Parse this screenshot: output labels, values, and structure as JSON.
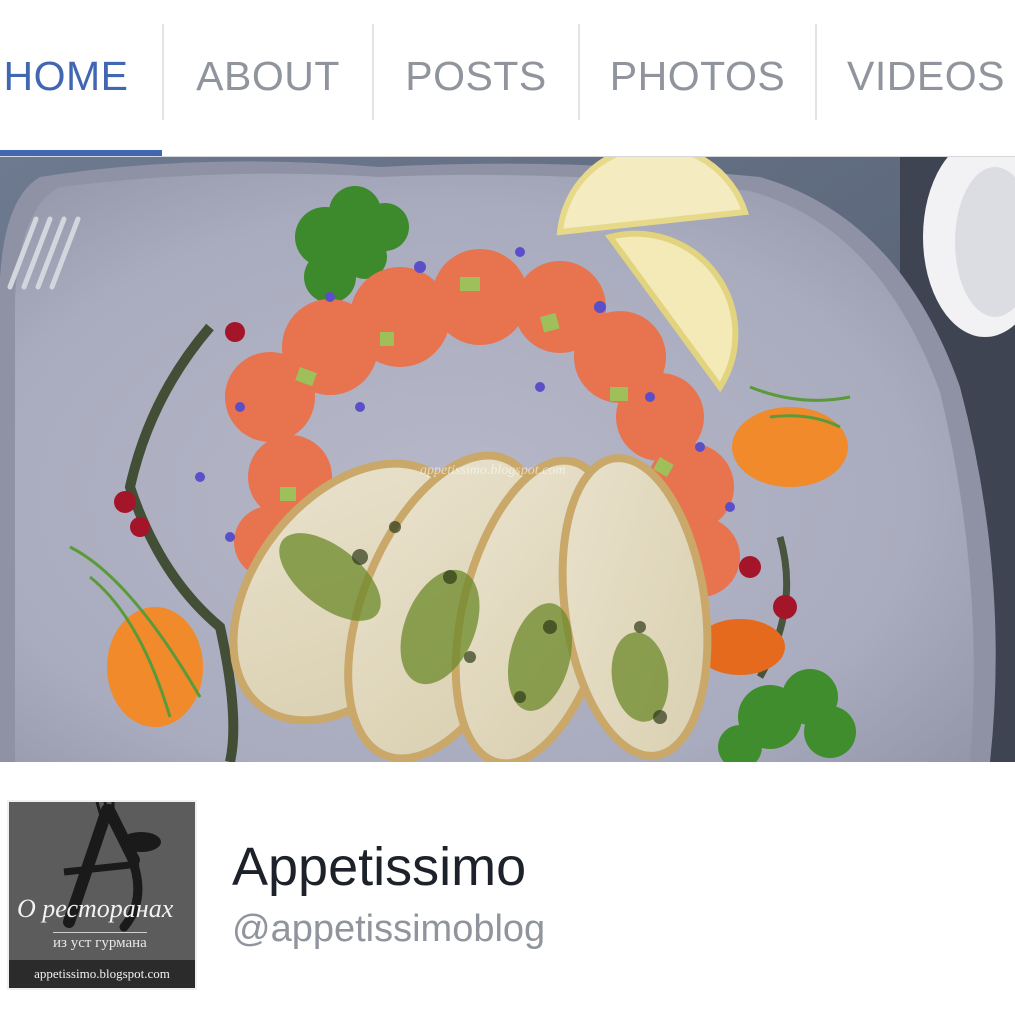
{
  "tabs": [
    {
      "label": "HOME",
      "active": true
    },
    {
      "label": "ABOUT",
      "active": false
    },
    {
      "label": "POSTS",
      "active": false
    },
    {
      "label": "PHOTOS",
      "active": false
    },
    {
      "label": "VIDEOS",
      "active": false
    }
  ],
  "profile": {
    "name": "Appetissimo",
    "handle": "@appetissimoblog",
    "avatar": {
      "script_line": "О ресторанах",
      "subline": "из уст гурмана",
      "site": "appetissimo.blogspot.com"
    }
  },
  "cover": {
    "watermark": "appetissimo.blogspot.com"
  },
  "colors": {
    "accent": "#4267b2",
    "inactive_tab": "#90949c",
    "name_text": "#1d2129"
  }
}
